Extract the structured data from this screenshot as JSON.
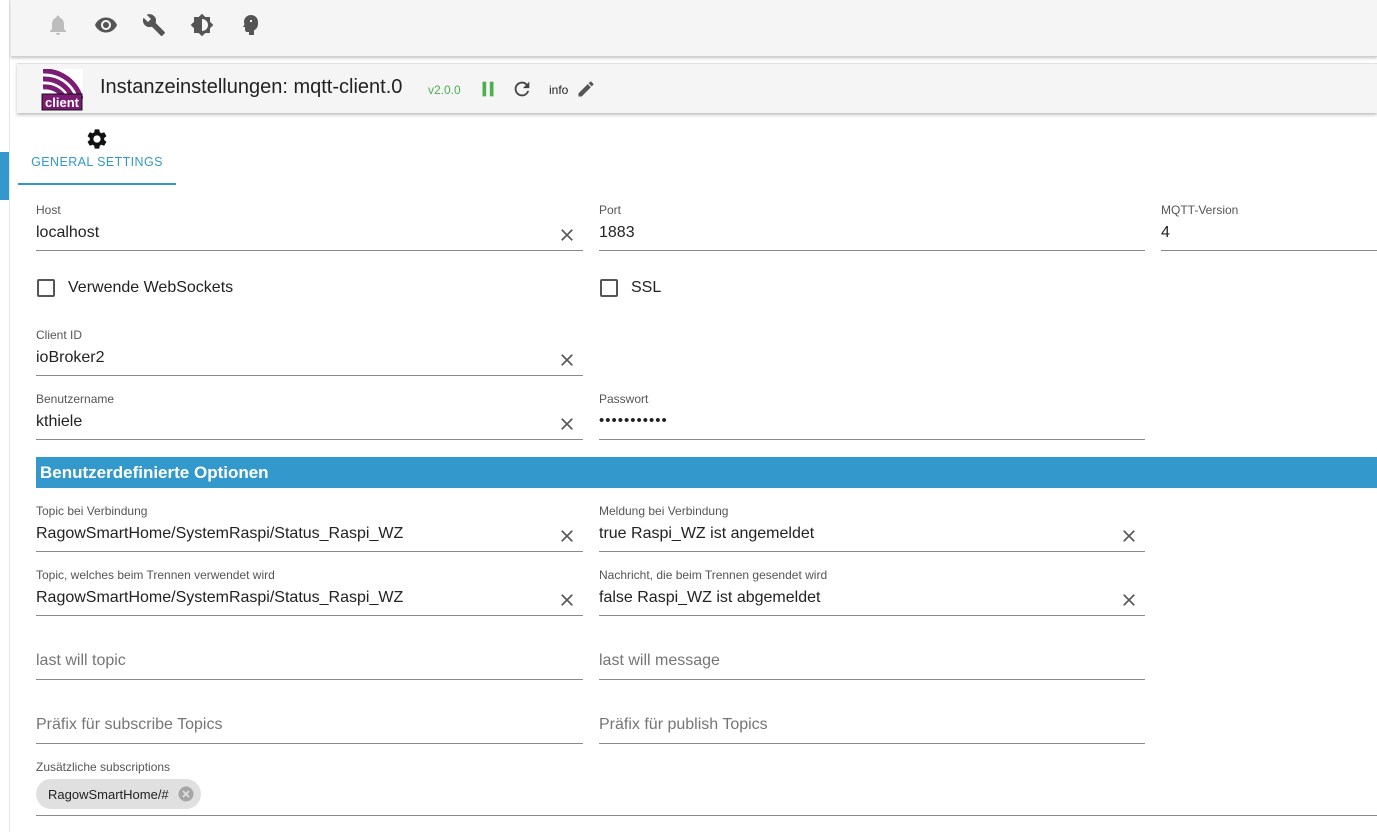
{
  "toolbar": {
    "icons": [
      "bell-icon",
      "eye-icon",
      "wrench-icon",
      "brightness-icon",
      "expert-mode-icon"
    ]
  },
  "header": {
    "logo_text": "client",
    "title": "Instanzeinstellungen: mqtt-client.0",
    "version": "v2.0.0",
    "info_label": "info"
  },
  "tabs": [
    {
      "label": "GENERAL SETTINGS",
      "icon": "gear-icon",
      "active": true
    }
  ],
  "form": {
    "host": {
      "label": "Host",
      "value": "localhost"
    },
    "port": {
      "label": "Port",
      "value": "1883"
    },
    "mqtt_version": {
      "label": "MQTT-Version",
      "value": "4"
    },
    "websockets": {
      "label": "Verwende WebSockets",
      "checked": false
    },
    "ssl": {
      "label": "SSL",
      "checked": false
    },
    "client_id": {
      "label": "Client ID",
      "value": "ioBroker2"
    },
    "username": {
      "label": "Benutzername",
      "value": "kthiele"
    },
    "password": {
      "label": "Passwort",
      "value": "•••••••••••"
    }
  },
  "custom_section": {
    "title": "Benutzerdefinierte Optionen",
    "connect_topic": {
      "label": "Topic bei Verbindung",
      "value": "RagowSmartHome/SystemRaspi/Status_Raspi_WZ"
    },
    "connect_message": {
      "label": "Meldung bei Verbindung",
      "value": "true Raspi_WZ ist angemeldet"
    },
    "disconnect_topic": {
      "label": "Topic, welches beim Trennen verwendet wird",
      "value": "RagowSmartHome/SystemRaspi/Status_Raspi_WZ"
    },
    "disconnect_message": {
      "label": "Nachricht, die beim Trennen gesendet wird",
      "value": "false Raspi_WZ ist abgemeldet"
    },
    "last_will_topic": {
      "placeholder": "last will topic"
    },
    "last_will_message": {
      "placeholder": "last will message"
    },
    "subscribe_prefix": {
      "placeholder": "Präfix für subscribe Topics"
    },
    "publish_prefix": {
      "placeholder": "Präfix für publish Topics"
    },
    "subscriptions": {
      "label": "Zusätzliche subscriptions",
      "chips": [
        "RagowSmartHome/#"
      ]
    }
  },
  "colors": {
    "accent": "#3399cc",
    "version_green": "#4caf50"
  }
}
